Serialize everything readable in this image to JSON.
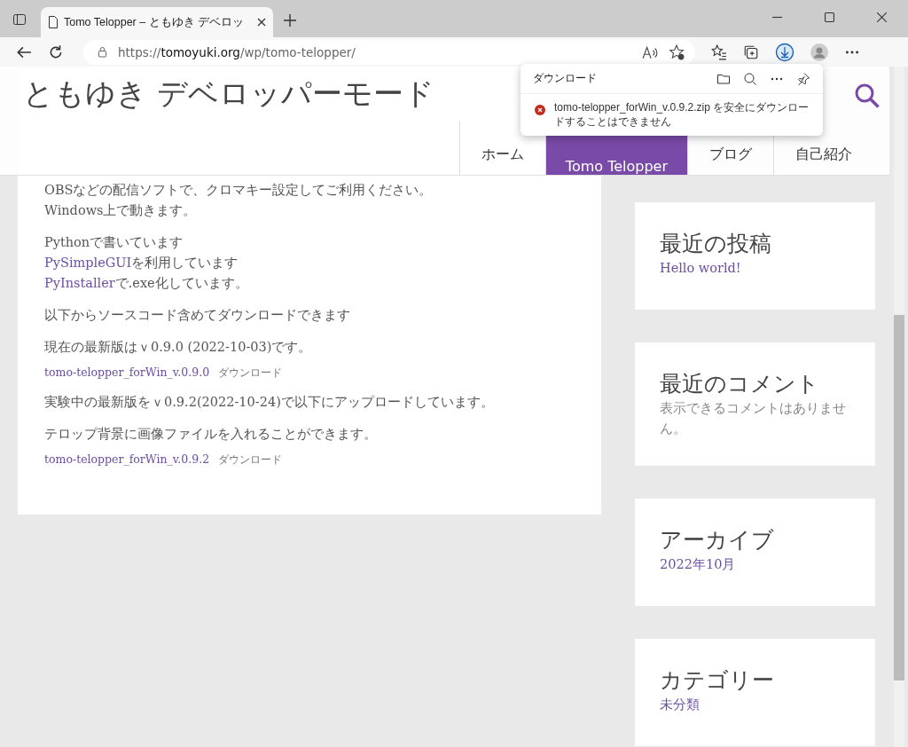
{
  "browser": {
    "tab_title": "Tomo Telopper – ともゆき デベロッ",
    "url_prefix": "https://",
    "url_host": "tomoyuki.org",
    "url_path": "/wp/tomo-telopper/"
  },
  "download_panel": {
    "title": "ダウンロード",
    "message": "tomo-telopper_forWin_v.0.9.2.zip を安全にダウンロードすることはできません"
  },
  "site": {
    "title": "ともゆき デベロッパーモード",
    "nav": [
      {
        "label": "ホーム",
        "selected": false
      },
      {
        "label": "Tomo Telopper",
        "selected": true
      },
      {
        "label": "ブログ",
        "selected": false
      },
      {
        "label": "自己紹介",
        "selected": false
      }
    ]
  },
  "article": {
    "blocks": [
      {
        "kind": "para",
        "lines": [
          {
            "text": "OBSなどの配信ソフトで、クロマキー設定してご利用ください。"
          },
          {
            "text": "Windows上で動きます。"
          }
        ]
      },
      {
        "kind": "para",
        "lines": [
          {
            "text": "Pythonで書いています"
          },
          {
            "link": "PySimpleGUI",
            "text": "を利用しています"
          },
          {
            "link": "PyInstaller",
            "text": "で.exe化しています。"
          }
        ]
      },
      {
        "kind": "para",
        "lines": [
          {
            "text": "以下からソースコード含めてダウンロードできます"
          }
        ]
      },
      {
        "kind": "para",
        "lines": [
          {
            "text": "現在の最新版はｖ0.9.0 (2022-10-03)です。"
          }
        ]
      },
      {
        "kind": "file",
        "name": "tomo-telopper_forWin_v.0.9.0",
        "action": "ダウンロード"
      },
      {
        "kind": "para",
        "lines": [
          {
            "text": "実験中の最新版をｖ0.9.2(2022-10-24)で以下にアップロードしています。"
          }
        ]
      },
      {
        "kind": "para",
        "lines": [
          {
            "text": "テロップ背景に画像ファイルを入れることができます。"
          }
        ]
      },
      {
        "kind": "file",
        "name": "tomo-telopper_forWin_v.0.9.2",
        "action": "ダウンロード"
      }
    ]
  },
  "widgets": [
    {
      "title": "最近の投稿",
      "body": "Hello world!",
      "link": true
    },
    {
      "title": "最近のコメント",
      "body": "表示できるコメントはありません。",
      "link": false
    },
    {
      "title": "アーカイブ",
      "body": "2022年10月",
      "link": true
    },
    {
      "title": "カテゴリー",
      "body": "未分類",
      "link": true
    }
  ]
}
